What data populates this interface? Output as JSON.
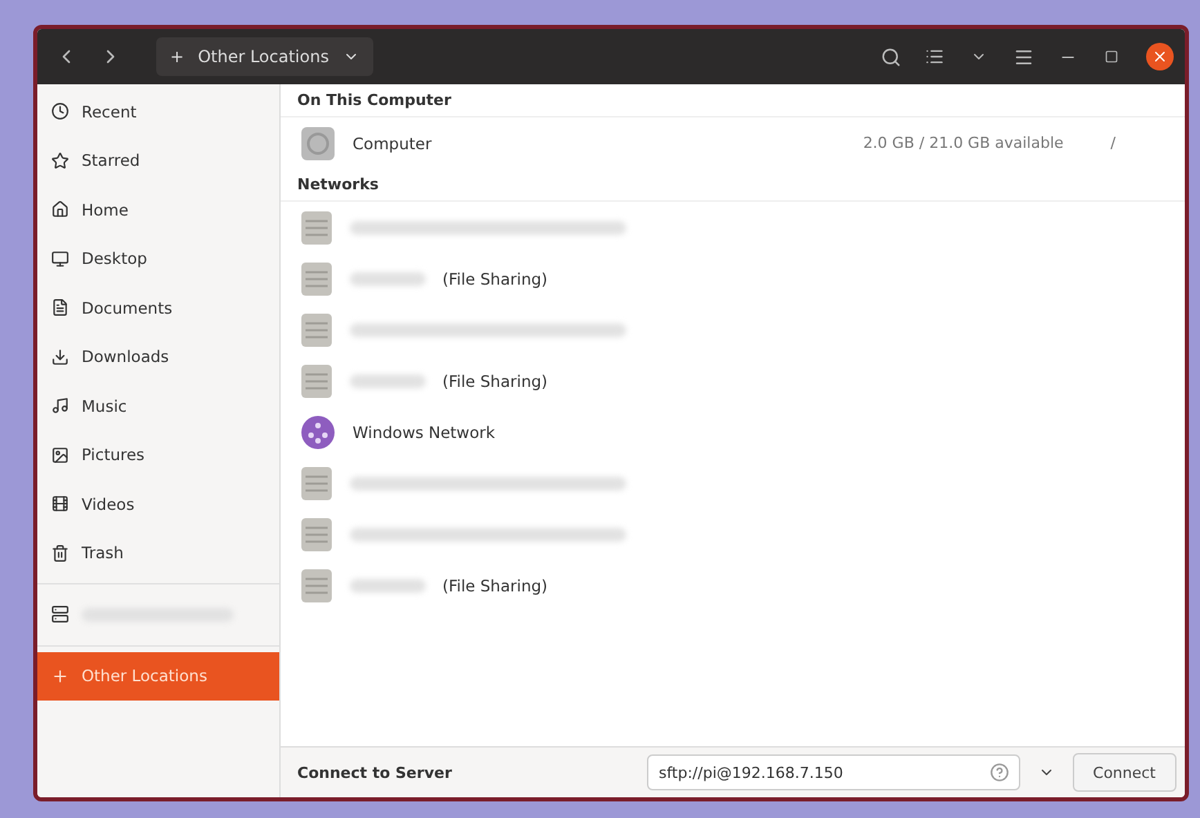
{
  "header": {
    "location": "Other Locations",
    "add_symbol": "+"
  },
  "sidebar": {
    "items": [
      {
        "label": "Recent",
        "selected": false,
        "kind": "place"
      },
      {
        "label": "Starred",
        "selected": false,
        "kind": "place"
      },
      {
        "label": "Home",
        "selected": false,
        "kind": "place"
      },
      {
        "label": "Desktop",
        "selected": false,
        "kind": "place"
      },
      {
        "label": "Documents",
        "selected": false,
        "kind": "place"
      },
      {
        "label": "Downloads",
        "selected": false,
        "kind": "place"
      },
      {
        "label": "Music",
        "selected": false,
        "kind": "place"
      },
      {
        "label": "Pictures",
        "selected": false,
        "kind": "place"
      },
      {
        "label": "Videos",
        "selected": false,
        "kind": "place"
      },
      {
        "label": "Trash",
        "selected": false,
        "kind": "place"
      },
      {
        "kind": "device",
        "selected": false
      },
      {
        "label": "Other Locations",
        "selected": true,
        "kind": "place"
      }
    ]
  },
  "sections": [
    {
      "title": "On This Computer",
      "rows": [
        {
          "kind": "computer",
          "name": "Computer",
          "space": "2.0 GB / 21.0 GB available",
          "mount": "/"
        }
      ]
    },
    {
      "title": "Networks",
      "rows": [
        {
          "kind": "server"
        },
        {
          "kind": "server",
          "suffix": "(File Sharing)"
        },
        {
          "kind": "server"
        },
        {
          "kind": "server",
          "suffix": "(File Sharing)"
        },
        {
          "kind": "windows",
          "name": "Windows Network"
        },
        {
          "kind": "server"
        },
        {
          "kind": "server"
        },
        {
          "kind": "server",
          "suffix": "(File Sharing)"
        }
      ]
    }
  ],
  "connect": {
    "label": "Connect to Server",
    "value": "sftp://pi@192.168.7.150",
    "button": "Connect"
  }
}
